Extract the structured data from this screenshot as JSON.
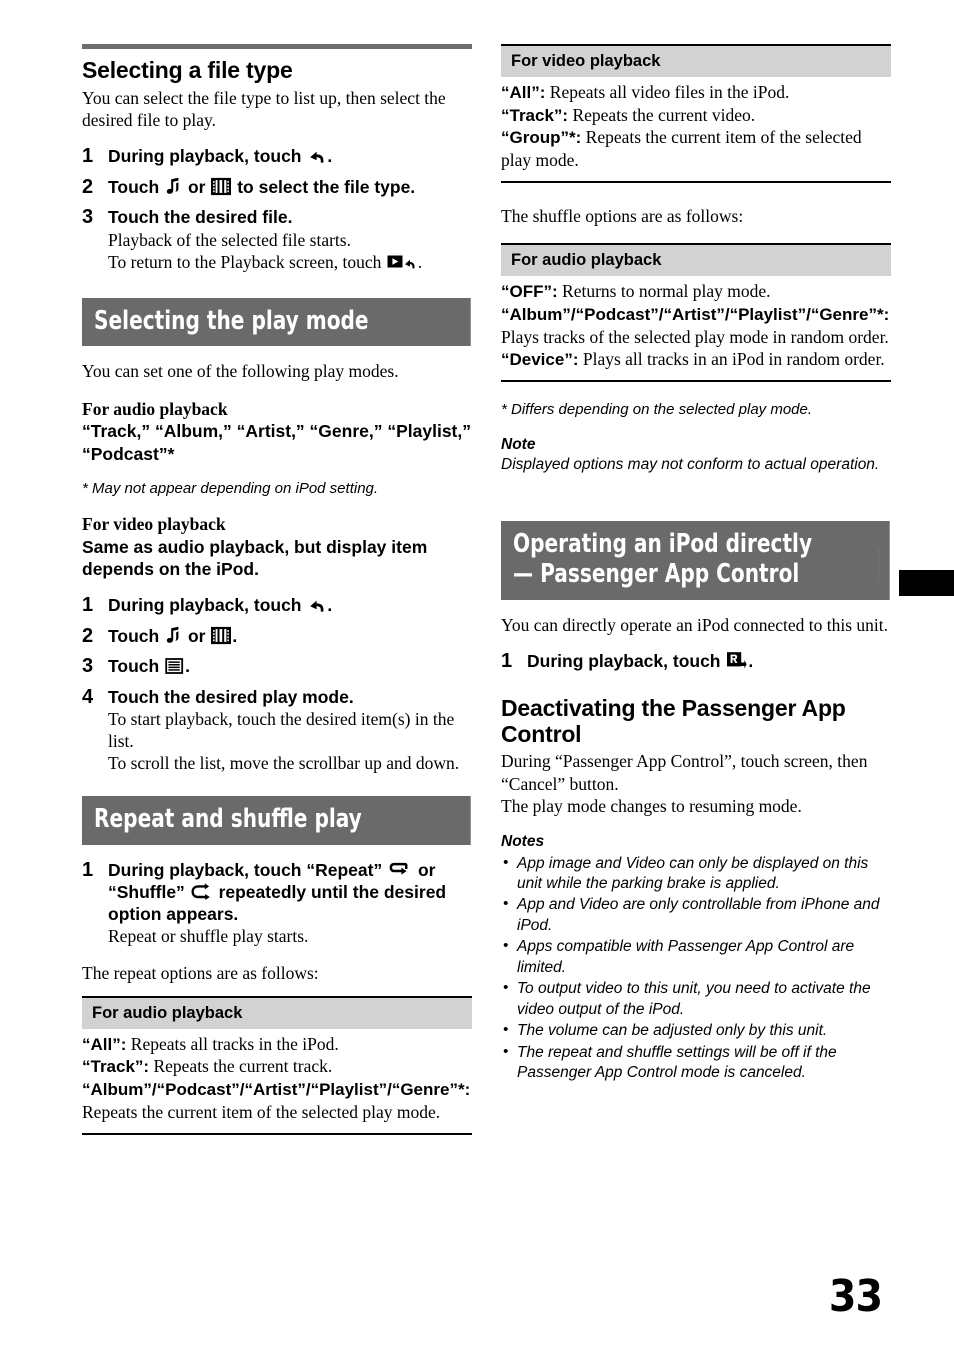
{
  "page": {
    "number": "33"
  },
  "left_column": {
    "file_type": {
      "title": "Selecting a file type",
      "intro": "You can select the file type to list up, then select the desired file to play.",
      "steps": [
        {
          "num": "1",
          "head_before": "During playback, touch",
          "icon": "return-arrow-icon",
          "head_after": "."
        },
        {
          "num": "2",
          "head_before": "Touch",
          "icon": "music-note-icon",
          "head_mid": "or",
          "icon2": "film-strip-icon",
          "head_after": "to select the file type."
        },
        {
          "num": "3",
          "head": "Touch the desired file.",
          "detail1": "Playback of the selected file starts.",
          "detail2_before": "To return to the Playback screen, touch",
          "detail2_icon": "play-return-icon",
          "detail2_after": "."
        }
      ]
    },
    "play_mode": {
      "band": "Selecting the play mode",
      "intro": "You can set one of the following play modes.",
      "audio_label": "For audio playback",
      "audio_modes": "“Track,” “Album,” “Artist,” “Genre,” “Playlist,” “Podcast”*",
      "footnote": "* May not appear depending on iPod setting.",
      "video_label": "For video playback",
      "video_modes": "Same as audio playback, but display item depends on the iPod.",
      "steps": [
        {
          "num": "1",
          "head_before": "During playback, touch",
          "icon": "return-arrow-icon",
          "head_after": "."
        },
        {
          "num": "2",
          "head_before": "Touch",
          "icon": "music-note-icon",
          "head_mid": "or",
          "icon2": "film-strip-icon",
          "head_after": "."
        },
        {
          "num": "3",
          "head_before": "Touch",
          "icon": "list-menu-icon",
          "head_after": "."
        },
        {
          "num": "4",
          "head": "Touch the desired play mode.",
          "detail1": "To start playback, touch the desired item(s) in the list.",
          "detail2": "To scroll the list, move the scrollbar up and down."
        }
      ]
    },
    "repeat_shuffle": {
      "band": "Repeat and shuffle play",
      "step": {
        "num": "1",
        "head_p1": "During playback, touch “Repeat”",
        "icon1": "repeat-icon",
        "head_p2": "or “Shuffle”",
        "icon2": "shuffle-icon",
        "head_p3": "repeatedly until the desired option appears.",
        "detail": "Repeat or shuffle play starts."
      },
      "lead_in": "The repeat options are as follows:",
      "table_head": "For audio playback",
      "rows": [
        {
          "term": "“All”:",
          "text": "Repeats all tracks in the iPod."
        },
        {
          "term": "“Track”:",
          "text": "Repeats the current track."
        },
        {
          "term": "“Album”/“Podcast”/“Artist”/“Playlist”/“Genre”*:",
          "text": "Repeats the current item of the selected play mode."
        }
      ]
    }
  },
  "right_column": {
    "repeat_video": {
      "table_head": "For video playback",
      "rows": [
        {
          "term": "“All”:",
          "text": "Repeats all video files in the iPod."
        },
        {
          "term": "“Track”:",
          "text": "Repeats the current video."
        },
        {
          "term": "“Group”*:",
          "text": "Repeats the current item of the selected play mode."
        }
      ]
    },
    "shuffle_lead_in": "The shuffle options are as follows:",
    "shuffle_audio": {
      "table_head": "For audio playback",
      "rows": [
        {
          "term": "“OFF”:",
          "text": "Returns to normal play mode."
        },
        {
          "term": "“Album”/“Podcast”/“Artist”/“Playlist”/“Genre”*:",
          "text": "Plays tracks of the selected play mode in random order."
        },
        {
          "term": "“Device”:",
          "text": "Plays all tracks in an iPod in random order."
        }
      ]
    },
    "footnote": "* Differs depending on the selected play mode.",
    "note_label": "Note",
    "note_text": "Displayed options may not conform to actual operation.",
    "passenger": {
      "band_line1": "Operating an iPod directly",
      "band_line2": "— Passenger App Control",
      "intro": "You can directly operate an iPod connected to this unit.",
      "step": {
        "num": "1",
        "head_before": "During playback, touch",
        "icon": "passenger-app-icon",
        "head_after": "."
      },
      "deactivate_title": "Deactivating the Passenger App Control",
      "deactivate_text1": "During “Passenger App Control”, touch screen, then “Cancel” button.",
      "deactivate_text2": "The play mode changes to resuming mode.",
      "notes_label": "Notes",
      "notes": [
        "App image and Video can only be displayed on this unit while the parking brake is applied.",
        "App and Video are only controllable from iPhone and iPod.",
        "Apps compatible with Passenger App Control are limited.",
        "To output video to this unit, you need to activate the video output of the iPod.",
        "The volume can be adjusted only by this unit.",
        "The repeat and shuffle settings will be off if the Passenger App Control mode is canceled."
      ]
    }
  },
  "colors": {
    "band_gray": "#6a6a6a",
    "table_head_gray": "#d2d2d2",
    "rule_gray": "#6e6e6e"
  }
}
